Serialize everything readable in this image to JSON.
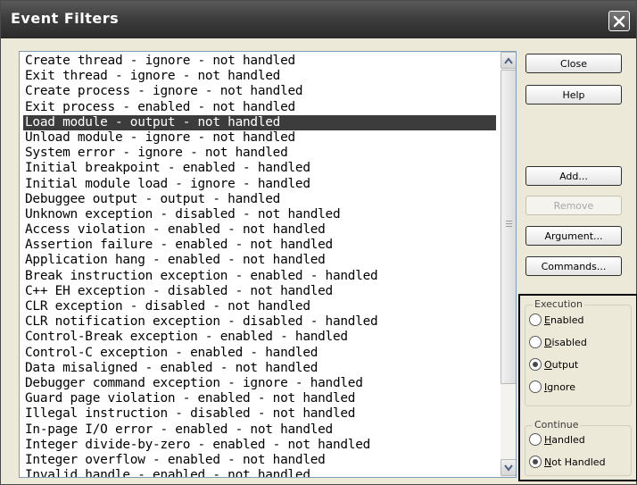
{
  "window": {
    "title": "Event Filters"
  },
  "events": [
    {
      "label": "Create thread - ignore - not handled",
      "selected": false
    },
    {
      "label": "Exit thread - ignore - not handled",
      "selected": false
    },
    {
      "label": "Create process - ignore - not handled",
      "selected": false
    },
    {
      "label": "Exit process - enabled - not handled",
      "selected": false
    },
    {
      "label": "Load module - output - not handled",
      "selected": true
    },
    {
      "label": "Unload module - ignore - not handled",
      "selected": false
    },
    {
      "label": "System error - ignore - not handled",
      "selected": false
    },
    {
      "label": "Initial breakpoint - enabled - handled",
      "selected": false
    },
    {
      "label": "Initial module load - ignore - handled",
      "selected": false
    },
    {
      "label": "Debuggee output - output - handled",
      "selected": false
    },
    {
      "label": "Unknown exception - disabled - not handled",
      "selected": false
    },
    {
      "label": "Access violation - enabled - not handled",
      "selected": false
    },
    {
      "label": "Assertion failure - enabled - not handled",
      "selected": false
    },
    {
      "label": "Application hang - enabled - not handled",
      "selected": false
    },
    {
      "label": "Break instruction exception - enabled - handled",
      "selected": false
    },
    {
      "label": "C++ EH exception - disabled - not handled",
      "selected": false
    },
    {
      "label": "CLR exception - disabled - not handled",
      "selected": false
    },
    {
      "label": "CLR notification exception - disabled - handled",
      "selected": false
    },
    {
      "label": "Control-Break exception - enabled - handled",
      "selected": false
    },
    {
      "label": "Control-C exception - enabled - handled",
      "selected": false
    },
    {
      "label": "Data misaligned - enabled - not handled",
      "selected": false
    },
    {
      "label": "Debugger command exception - ignore - handled",
      "selected": false
    },
    {
      "label": "Guard page violation - enabled - not handled",
      "selected": false
    },
    {
      "label": "Illegal instruction - disabled - not handled",
      "selected": false
    },
    {
      "label": "In-page I/O error - enabled - not handled",
      "selected": false
    },
    {
      "label": "Integer divide-by-zero - enabled - not handled",
      "selected": false
    },
    {
      "label": "Integer overflow - enabled - not handled",
      "selected": false
    },
    {
      "label": "Invalid handle - enabled - not handled",
      "selected": false
    }
  ],
  "buttons": {
    "close": "Close",
    "help": "Help",
    "add": "Add...",
    "remove": "Remove",
    "argument": "Argument...",
    "commands": "Commands..."
  },
  "execution": {
    "label": "Execution",
    "options": [
      "Enabled",
      "Disabled",
      "Output",
      "Ignore"
    ],
    "selected": "Output"
  },
  "continue": {
    "label": "Continue",
    "options": [
      "Handled",
      "Not Handled"
    ],
    "selected": "Not Handled"
  },
  "icons": {
    "close": "close-x-icon",
    "scroll_up": "arrow-up-icon",
    "scroll_down": "arrow-down-icon"
  },
  "colors": {
    "titlebar": "#3e3e3e",
    "selection": "#3c3c3c",
    "dialog_bg": "#ece9d8"
  }
}
